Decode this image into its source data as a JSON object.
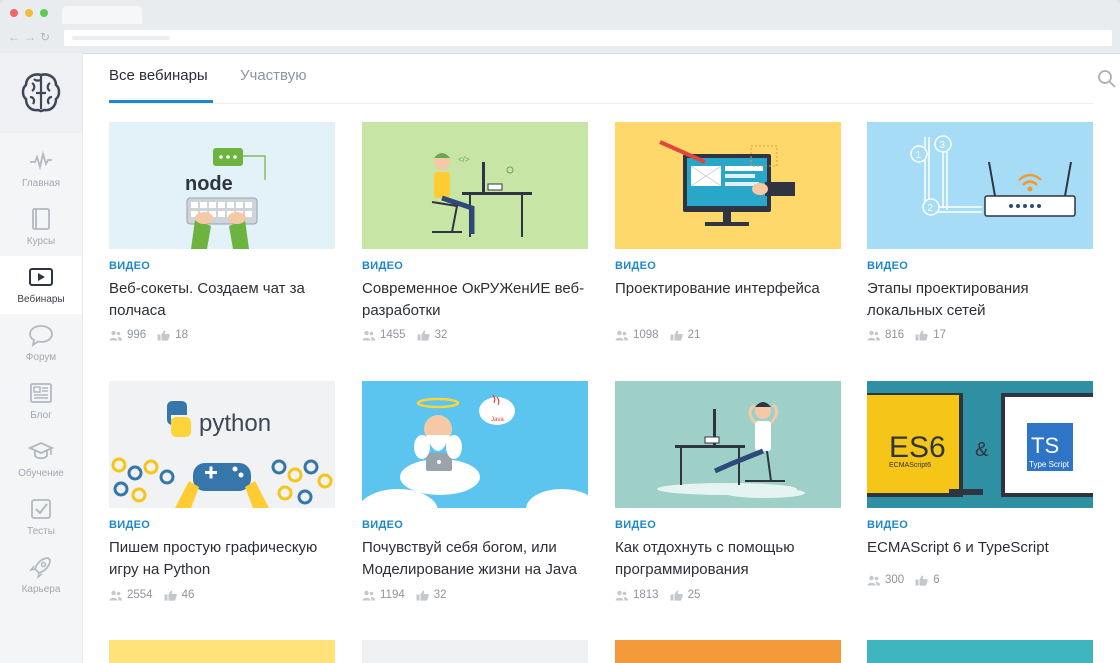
{
  "tabs": {
    "all": "Все вебинары",
    "participating": "Участвую"
  },
  "sidebar": {
    "items": [
      {
        "key": "home",
        "label": "Главная",
        "icon": "pulse-icon"
      },
      {
        "key": "courses",
        "label": "Курсы",
        "icon": "book-icon"
      },
      {
        "key": "webinars",
        "label": "Вебинары",
        "icon": "play-icon",
        "active": true
      },
      {
        "key": "forum",
        "label": "Форум",
        "icon": "chat-bubble-icon"
      },
      {
        "key": "blog",
        "label": "Блог",
        "icon": "newspaper-icon"
      },
      {
        "key": "education",
        "label": "Обучение",
        "icon": "graduation-cap-icon"
      },
      {
        "key": "tests",
        "label": "Тесты",
        "icon": "checkbox-icon"
      },
      {
        "key": "career",
        "label": "Карьера",
        "icon": "rocket-icon"
      }
    ]
  },
  "cards": [
    {
      "type": "ВИДЕО",
      "title": "Веб-сокеты. Создаем чат за полчаса",
      "views": "996",
      "likes": "18",
      "bg": "#e3f1f8",
      "thumb_text": "node",
      "thumb_icon": "nodejs-keyboard-illustration"
    },
    {
      "type": "ВИДЕО",
      "title": "Современное ОкРУЖенИЕ веб-разработки",
      "views": "1455",
      "likes": "32",
      "bg": "#c7e5a4",
      "thumb_icon": "developer-at-desk-illustration"
    },
    {
      "type": "ВИДЕО",
      "title": "Проектирование интерфейса",
      "views": "1098",
      "likes": "21",
      "bg": "#ffd86b",
      "thumb_icon": "monitor-design-illustration"
    },
    {
      "type": "ВИДЕО",
      "title": "Этапы проектирования локальных сетей",
      "views": "816",
      "likes": "17",
      "bg": "#a6dcf6",
      "thumb_icon": "router-network-illustration"
    },
    {
      "type": "ВИДЕО",
      "title": "Пишем простую графическую игру на Python",
      "views": "2554",
      "likes": "46",
      "bg": "#f0f2f4",
      "thumb_text": "python",
      "thumb_icon": "python-gamepad-illustration"
    },
    {
      "type": "ВИДЕО",
      "title": "Почувствуй себя богом, или Моделирование жизни на Java",
      "views": "1194",
      "likes": "32",
      "bg": "#5bc4ef",
      "thumb_text": "Java",
      "thumb_icon": "god-on-cloud-illustration"
    },
    {
      "type": "ВИДЕО",
      "title": "Как отдохнуть с помощью программирования",
      "views": "1813",
      "likes": "25",
      "bg": "#9fd0c8",
      "thumb_icon": "relaxing-developer-illustration"
    },
    {
      "type": "ВИДЕО",
      "title": "ECMAScript 6 и TypeScript",
      "views": "300",
      "likes": "6",
      "bg": "#2f8fa3",
      "thumb_es6": "ES6",
      "thumb_es6_sub": "ECMAScript6",
      "thumb_amp": "&",
      "thumb_ts": "TS",
      "thumb_ts_sub": "Type Script",
      "thumb_icon": "es6-typescript-illustration"
    }
  ],
  "bottom_row_colors": [
    "#ffe27a",
    "#eef0f2",
    "#f59a3a",
    "#3fb6bf"
  ],
  "colors": {
    "accent": "#1f88c8",
    "sidebar_bg": "#f4f5f7",
    "text_primary": "#2a2f36",
    "text_muted": "#8e959e"
  }
}
